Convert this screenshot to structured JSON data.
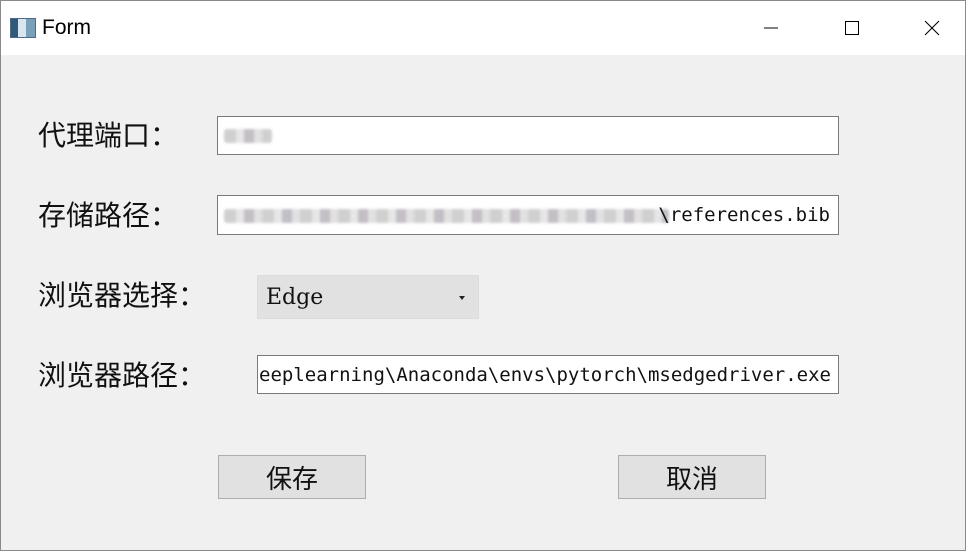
{
  "window": {
    "title": "Form",
    "app_icon": "form-app-icon",
    "controls": {
      "minimize_icon": "minimize-icon",
      "maximize_icon": "maximize-icon",
      "close_icon": "close-icon"
    }
  },
  "form": {
    "proxy_port": {
      "label": "代理端口：",
      "value": ""
    },
    "storage_path": {
      "label": "存储路径：",
      "value_visible": "\\references.bib"
    },
    "browser_select": {
      "label": "浏览器选择：",
      "selected": "Edge"
    },
    "browser_path": {
      "label": "浏览器路径：",
      "value": "\\Deeplearning\\Anaconda\\envs\\pytorch\\msedgedriver.exe"
    }
  },
  "buttons": {
    "save": "保存",
    "cancel": "取消"
  }
}
